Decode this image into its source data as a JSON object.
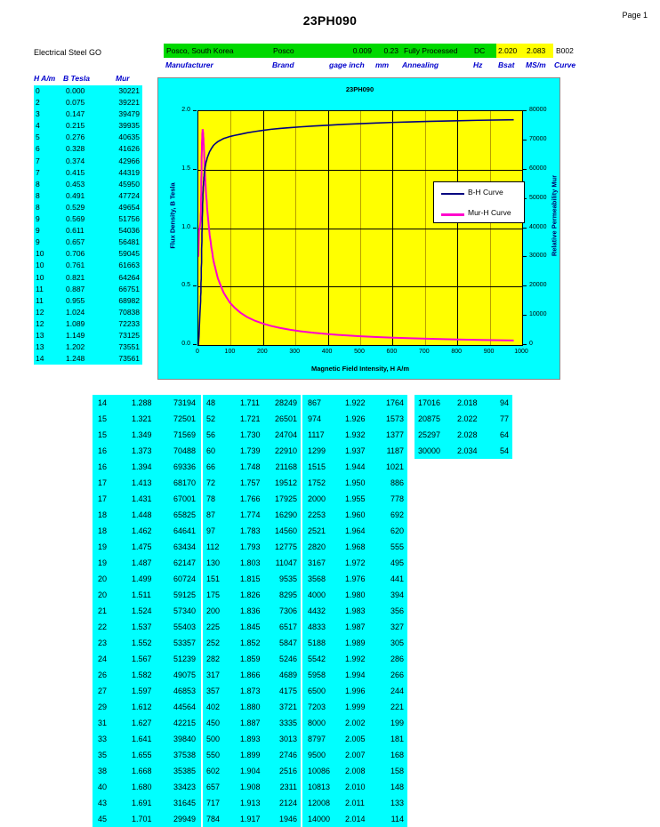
{
  "document": {
    "title": "23PH090",
    "page_label": "Page 1",
    "material_class": "Electrical Steel GO"
  },
  "spec": {
    "values": {
      "manufacturer": "Posco, South Korea",
      "brand": "Posco",
      "gage_inch": "0.009",
      "mm": "0.23",
      "annealing": "Fully Processed",
      "hz": "DC",
      "bsat": "2.020",
      "ms_m": "2.083",
      "curve": "B002"
    },
    "labels": {
      "manufacturer": "Manufacturer",
      "brand": "Brand",
      "gage_inch": "gage inch",
      "mm": "mm",
      "annealing": "Annealing",
      "hz": "Hz",
      "bsat": "Bsat",
      "ms_m": "MS/m",
      "curve": "Curve"
    },
    "colors": {
      "green": "#00d900",
      "yellow": "#ffff00",
      "label_blue": "#0000cc"
    }
  },
  "left_table": {
    "headers": [
      "H A/m",
      "B Tesla",
      "Mur"
    ],
    "rows": [
      [
        "0",
        "0.000",
        "30221"
      ],
      [
        "2",
        "0.075",
        "39221"
      ],
      [
        "3",
        "0.147",
        "39479"
      ],
      [
        "4",
        "0.215",
        "39935"
      ],
      [
        "5",
        "0.276",
        "40635"
      ],
      [
        "6",
        "0.328",
        "41626"
      ],
      [
        "7",
        "0.374",
        "42966"
      ],
      [
        "7",
        "0.415",
        "44319"
      ],
      [
        "8",
        "0.453",
        "45950"
      ],
      [
        "8",
        "0.491",
        "47724"
      ],
      [
        "8",
        "0.529",
        "49654"
      ],
      [
        "9",
        "0.569",
        "51756"
      ],
      [
        "9",
        "0.611",
        "54036"
      ],
      [
        "9",
        "0.657",
        "56481"
      ],
      [
        "10",
        "0.706",
        "59045"
      ],
      [
        "10",
        "0.761",
        "61663"
      ],
      [
        "10",
        "0.821",
        "64264"
      ],
      [
        "11",
        "0.887",
        "66751"
      ],
      [
        "11",
        "0.955",
        "68982"
      ],
      [
        "12",
        "1.024",
        "70838"
      ],
      [
        "12",
        "1.089",
        "72233"
      ],
      [
        "13",
        "1.149",
        "73125"
      ],
      [
        "13",
        "1.202",
        "73551"
      ],
      [
        "14",
        "1.248",
        "73561"
      ]
    ]
  },
  "bottom_tables": [
    {
      "rows": [
        [
          "14",
          "1.288",
          "73194"
        ],
        [
          "15",
          "1.321",
          "72501"
        ],
        [
          "15",
          "1.349",
          "71569"
        ],
        [
          "16",
          "1.373",
          "70488"
        ],
        [
          "16",
          "1.394",
          "69336"
        ],
        [
          "17",
          "1.413",
          "68170"
        ],
        [
          "17",
          "1.431",
          "67001"
        ],
        [
          "18",
          "1.448",
          "65825"
        ],
        [
          "18",
          "1.462",
          "64641"
        ],
        [
          "19",
          "1.475",
          "63434"
        ],
        [
          "19",
          "1.487",
          "62147"
        ],
        [
          "20",
          "1.499",
          "60724"
        ],
        [
          "20",
          "1.511",
          "59125"
        ],
        [
          "21",
          "1.524",
          "57340"
        ],
        [
          "22",
          "1.537",
          "55403"
        ],
        [
          "23",
          "1.552",
          "53357"
        ],
        [
          "24",
          "1.567",
          "51239"
        ],
        [
          "26",
          "1.582",
          "49075"
        ],
        [
          "27",
          "1.597",
          "46853"
        ],
        [
          "29",
          "1.612",
          "44564"
        ],
        [
          "31",
          "1.627",
          "42215"
        ],
        [
          "33",
          "1.641",
          "39840"
        ],
        [
          "35",
          "1.655",
          "37538"
        ],
        [
          "38",
          "1.668",
          "35385"
        ],
        [
          "40",
          "1.680",
          "33423"
        ],
        [
          "43",
          "1.691",
          "31645"
        ],
        [
          "45",
          "1.701",
          "29949"
        ]
      ]
    },
    {
      "rows": [
        [
          "48",
          "1.711",
          "28249"
        ],
        [
          "52",
          "1.721",
          "26501"
        ],
        [
          "56",
          "1.730",
          "24704"
        ],
        [
          "60",
          "1.739",
          "22910"
        ],
        [
          "66",
          "1.748",
          "21168"
        ],
        [
          "72",
          "1.757",
          "19512"
        ],
        [
          "78",
          "1.766",
          "17925"
        ],
        [
          "87",
          "1.774",
          "16290"
        ],
        [
          "97",
          "1.783",
          "14560"
        ],
        [
          "112",
          "1.793",
          "12775"
        ],
        [
          "130",
          "1.803",
          "11047"
        ],
        [
          "151",
          "1.815",
          "9535"
        ],
        [
          "175",
          "1.826",
          "8295"
        ],
        [
          "200",
          "1.836",
          "7306"
        ],
        [
          "225",
          "1.845",
          "6517"
        ],
        [
          "252",
          "1.852",
          "5847"
        ],
        [
          "282",
          "1.859",
          "5246"
        ],
        [
          "317",
          "1.866",
          "4689"
        ],
        [
          "357",
          "1.873",
          "4175"
        ],
        [
          "402",
          "1.880",
          "3721"
        ],
        [
          "450",
          "1.887",
          "3335"
        ],
        [
          "500",
          "1.893",
          "3013"
        ],
        [
          "550",
          "1.899",
          "2746"
        ],
        [
          "602",
          "1.904",
          "2516"
        ],
        [
          "657",
          "1.908",
          "2311"
        ],
        [
          "717",
          "1.913",
          "2124"
        ],
        [
          "784",
          "1.917",
          "1946"
        ]
      ]
    },
    {
      "rows": [
        [
          "867",
          "1.922",
          "1764"
        ],
        [
          "974",
          "1.926",
          "1573"
        ],
        [
          "1117",
          "1.932",
          "1377"
        ],
        [
          "1299",
          "1.937",
          "1187"
        ],
        [
          "1515",
          "1.944",
          "1021"
        ],
        [
          "1752",
          "1.950",
          "886"
        ],
        [
          "2000",
          "1.955",
          "778"
        ],
        [
          "2253",
          "1.960",
          "692"
        ],
        [
          "2521",
          "1.964",
          "620"
        ],
        [
          "2820",
          "1.968",
          "555"
        ],
        [
          "3167",
          "1.972",
          "495"
        ],
        [
          "3568",
          "1.976",
          "441"
        ],
        [
          "4000",
          "1.980",
          "394"
        ],
        [
          "4432",
          "1.983",
          "356"
        ],
        [
          "4833",
          "1.987",
          "327"
        ],
        [
          "5188",
          "1.989",
          "305"
        ],
        [
          "5542",
          "1.992",
          "286"
        ],
        [
          "5958",
          "1.994",
          "266"
        ],
        [
          "6500",
          "1.996",
          "244"
        ],
        [
          "7203",
          "1.999",
          "221"
        ],
        [
          "8000",
          "2.002",
          "199"
        ],
        [
          "8797",
          "2.005",
          "181"
        ],
        [
          "9500",
          "2.007",
          "168"
        ],
        [
          "10086",
          "2.008",
          "158"
        ],
        [
          "10813",
          "2.010",
          "148"
        ],
        [
          "12008",
          "2.011",
          "133"
        ],
        [
          "14000",
          "2.014",
          "114"
        ]
      ]
    },
    {
      "rows": [
        [
          "17016",
          "2.018",
          "94"
        ],
        [
          "20875",
          "2.022",
          "77"
        ],
        [
          "25297",
          "2.028",
          "64"
        ],
        [
          "30000",
          "2.034",
          "54"
        ]
      ]
    }
  ],
  "chart_data": {
    "type": "line",
    "title": "23PH090",
    "xlabel": "Magnetic Field Intensity, H A/m",
    "ylabel": "Flux Density, B Tesla",
    "y2label": "Relative Permeability Mur",
    "xlim": [
      0,
      1000
    ],
    "ylim": [
      0.0,
      2.0
    ],
    "y2lim": [
      0,
      80000
    ],
    "xticks": [
      "0",
      "100",
      "200",
      "300",
      "400",
      "500",
      "600",
      "700",
      "800",
      "900",
      "1000"
    ],
    "yticks": [
      "0.0",
      "0.5",
      "1.0",
      "1.5",
      "2.0"
    ],
    "y2ticks": [
      "0",
      "10000",
      "20000",
      "30000",
      "40000",
      "50000",
      "60000",
      "70000",
      "80000"
    ],
    "grid": true,
    "legend_position": "center-right",
    "plot_bg": "#ffff00",
    "panel_bg": "#00ffff",
    "series": [
      {
        "name": "B-H Curve",
        "color": "#000080",
        "axis": "left",
        "x": [
          0,
          2,
          3,
          4,
          5,
          6,
          7,
          7,
          8,
          8,
          8,
          9,
          9,
          9,
          10,
          10,
          10,
          11,
          11,
          12,
          12,
          13,
          13,
          14,
          14,
          15,
          15,
          16,
          16,
          17,
          17,
          18,
          18,
          19,
          19,
          20,
          20,
          21,
          22,
          23,
          24,
          26,
          27,
          29,
          31,
          33,
          35,
          38,
          40,
          43,
          45,
          48,
          52,
          56,
          60,
          66,
          72,
          78,
          87,
          97,
          112,
          130,
          151,
          175,
          200,
          225,
          252,
          282,
          317,
          357,
          402,
          450,
          500,
          550,
          602,
          657,
          717,
          784,
          867,
          974
        ],
        "y": [
          0.0,
          0.075,
          0.147,
          0.215,
          0.276,
          0.328,
          0.374,
          0.415,
          0.453,
          0.491,
          0.529,
          0.569,
          0.611,
          0.657,
          0.706,
          0.761,
          0.821,
          0.887,
          0.955,
          1.024,
          1.089,
          1.149,
          1.202,
          1.248,
          1.288,
          1.321,
          1.349,
          1.373,
          1.394,
          1.413,
          1.431,
          1.448,
          1.462,
          1.475,
          1.487,
          1.499,
          1.511,
          1.524,
          1.537,
          1.552,
          1.567,
          1.582,
          1.597,
          1.612,
          1.627,
          1.641,
          1.655,
          1.668,
          1.68,
          1.691,
          1.701,
          1.711,
          1.721,
          1.73,
          1.739,
          1.748,
          1.757,
          1.766,
          1.774,
          1.783,
          1.793,
          1.803,
          1.815,
          1.826,
          1.836,
          1.845,
          1.852,
          1.859,
          1.866,
          1.873,
          1.88,
          1.887,
          1.893,
          1.899,
          1.904,
          1.908,
          1.913,
          1.917,
          1.922,
          1.926
        ]
      },
      {
        "name": "Mur-H Curve",
        "color": "#ff00cc",
        "axis": "right",
        "x": [
          0,
          2,
          3,
          4,
          5,
          6,
          7,
          7,
          8,
          8,
          8,
          9,
          9,
          9,
          10,
          10,
          10,
          11,
          11,
          12,
          12,
          13,
          13,
          14,
          14,
          15,
          15,
          16,
          16,
          17,
          17,
          18,
          18,
          19,
          19,
          20,
          20,
          21,
          22,
          23,
          24,
          26,
          27,
          29,
          31,
          33,
          35,
          38,
          40,
          43,
          45,
          48,
          52,
          56,
          60,
          66,
          72,
          78,
          87,
          97,
          112,
          130,
          151,
          175,
          200,
          225,
          252,
          282,
          317,
          357,
          402,
          450,
          500,
          550,
          602,
          657,
          717,
          784,
          867,
          974
        ],
        "y": [
          30221,
          39221,
          39479,
          39935,
          40635,
          41626,
          42966,
          44319,
          45950,
          47724,
          49654,
          51756,
          54036,
          56481,
          59045,
          61663,
          64264,
          66751,
          68982,
          70838,
          72233,
          73125,
          73551,
          73561,
          73194,
          72501,
          71569,
          70488,
          69336,
          68170,
          67001,
          65825,
          64641,
          63434,
          62147,
          60724,
          59125,
          57340,
          55403,
          53357,
          51239,
          49075,
          46853,
          44564,
          42215,
          39840,
          37538,
          35385,
          33423,
          31645,
          29949,
          28249,
          26501,
          24704,
          22910,
          21168,
          19512,
          17925,
          16290,
          14560,
          12775,
          11047,
          9535,
          8295,
          7306,
          6517,
          5847,
          5246,
          4689,
          4175,
          3721,
          3335,
          3013,
          2746,
          2516,
          2311,
          2124,
          1946,
          1764,
          1573
        ]
      }
    ]
  }
}
